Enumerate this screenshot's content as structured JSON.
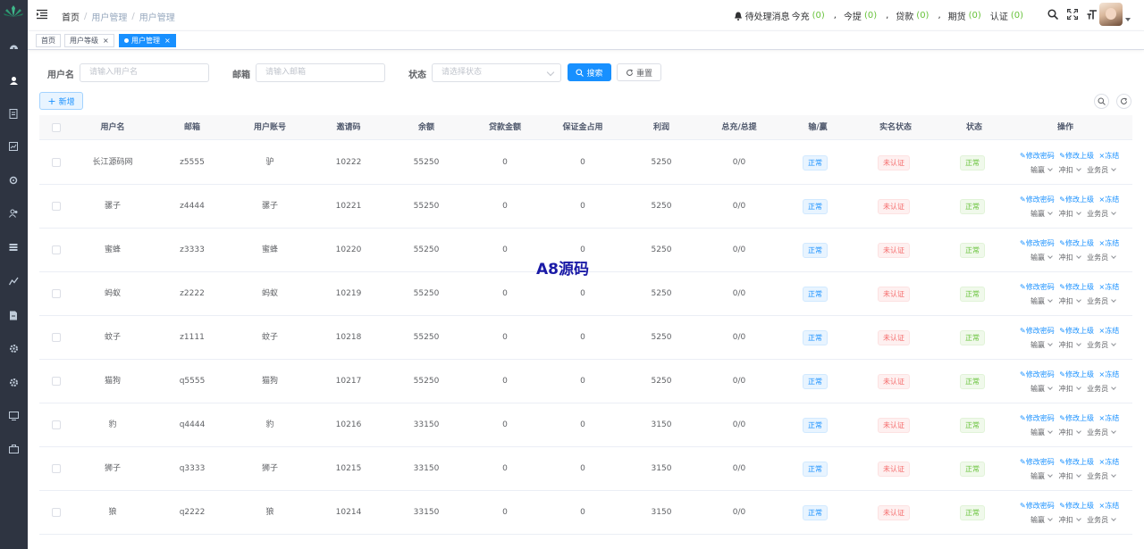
{
  "breadcrumb": {
    "home": "首页",
    "sep": "/",
    "level1": "用户管理",
    "level2": "用户管理"
  },
  "notify": {
    "label": "待处理消息",
    "items": [
      {
        "label": "今充",
        "count": "(0)"
      },
      {
        "label": "今提",
        "count": "(0)"
      },
      {
        "label": "贷款",
        "count": "(0)"
      },
      {
        "label": "期货",
        "count": "(0)"
      },
      {
        "label": "认证",
        "count": "(0)"
      }
    ],
    "separator": ","
  },
  "tags": [
    {
      "label": "首页"
    },
    {
      "label": "用户等级",
      "close": "×"
    },
    {
      "label": "用户管理",
      "close": "×"
    }
  ],
  "search": {
    "username_label": "用户名",
    "username_placeholder": "请输入用户名",
    "email_label": "邮箱",
    "email_placeholder": "请输入邮箱",
    "status_label": "状态",
    "status_placeholder": "请选择状态",
    "search_button": "搜索",
    "reset_button": "重置"
  },
  "add_button": "新增",
  "columns": [
    "用户名",
    "邮箱",
    "用户账号",
    "邀请码",
    "余额",
    "贷款金额",
    "保证金占用",
    "利润",
    "总充/总提",
    "输/赢",
    "实名状态",
    "状态",
    "操作"
  ],
  "ops": {
    "change_pwd": "修改密码",
    "change_parent": "修改上级",
    "freeze": "冻结",
    "win_lose": "输赢",
    "adjust": "冲扣",
    "salesman": "业务员"
  },
  "rows": [
    {
      "username": "长江源码网",
      "email": "z5555",
      "account": "驴",
      "invite": "10222",
      "balance": "55250",
      "loan": "0",
      "margin": "0",
      "profit": "5250",
      "totals": "0/0",
      "winlose": "正常",
      "realname": "未认证",
      "status": "正常"
    },
    {
      "username": "骡子",
      "email": "z4444",
      "account": "骡子",
      "invite": "10221",
      "balance": "55250",
      "loan": "0",
      "margin": "0",
      "profit": "5250",
      "totals": "0/0",
      "winlose": "正常",
      "realname": "未认证",
      "status": "正常"
    },
    {
      "username": "蜜蜂",
      "email": "z3333",
      "account": "蜜蜂",
      "invite": "10220",
      "balance": "55250",
      "loan": "0",
      "margin": "0",
      "profit": "5250",
      "totals": "0/0",
      "winlose": "正常",
      "realname": "未认证",
      "status": "正常"
    },
    {
      "username": "蚂蚁",
      "email": "z2222",
      "account": "蚂蚁",
      "invite": "10219",
      "balance": "55250",
      "loan": "0",
      "margin": "0",
      "profit": "5250",
      "totals": "0/0",
      "winlose": "正常",
      "realname": "未认证",
      "status": "正常"
    },
    {
      "username": "蚊子",
      "email": "z1111",
      "account": "蚊子",
      "invite": "10218",
      "balance": "55250",
      "loan": "0",
      "margin": "0",
      "profit": "5250",
      "totals": "0/0",
      "winlose": "正常",
      "realname": "未认证",
      "status": "正常"
    },
    {
      "username": "猫狗",
      "email": "q5555",
      "account": "猫狗",
      "invite": "10217",
      "balance": "55250",
      "loan": "0",
      "margin": "0",
      "profit": "5250",
      "totals": "0/0",
      "winlose": "正常",
      "realname": "未认证",
      "status": "正常"
    },
    {
      "username": "豹",
      "email": "q4444",
      "account": "豹",
      "invite": "10216",
      "balance": "33150",
      "loan": "0",
      "margin": "0",
      "profit": "3150",
      "totals": "0/0",
      "winlose": "正常",
      "realname": "未认证",
      "status": "正常"
    },
    {
      "username": "狮子",
      "email": "q3333",
      "account": "狮子",
      "invite": "10215",
      "balance": "33150",
      "loan": "0",
      "margin": "0",
      "profit": "3150",
      "totals": "0/0",
      "winlose": "正常",
      "realname": "未认证",
      "status": "正常"
    },
    {
      "username": "狼",
      "email": "q2222",
      "account": "狼",
      "invite": "10214",
      "balance": "33150",
      "loan": "0",
      "margin": "0",
      "profit": "3150",
      "totals": "0/0",
      "winlose": "正常",
      "realname": "未认证",
      "status": "正常"
    }
  ],
  "watermark": "A8源码",
  "colors": {
    "primary": "#1890ff",
    "sidebar": "#2e3441",
    "success": "#67c23a",
    "danger": "#f56c6c"
  }
}
